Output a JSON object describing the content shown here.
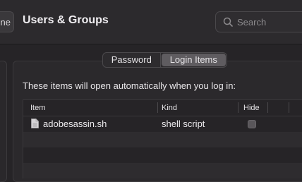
{
  "header": {
    "back_label": "one",
    "title": "Users & Groups",
    "search_placeholder": "Search"
  },
  "tabs": [
    {
      "label": "Password",
      "selected": false
    },
    {
      "label": "Login Items",
      "selected": true
    }
  ],
  "intro_text": "These items will open automatically when you log in:",
  "table": {
    "columns": [
      "Item",
      "Kind",
      "Hide"
    ],
    "rows": [
      {
        "item": "adobesassin.sh",
        "kind": "shell script",
        "hide": false
      }
    ]
  },
  "colors": {
    "window_bg": "#262427",
    "selected_tab_bg": "#5f5c60"
  }
}
